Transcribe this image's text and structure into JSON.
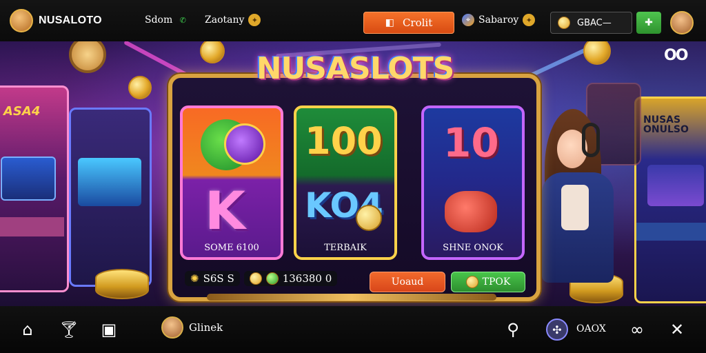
{
  "header": {
    "brand": "NUSALOTO",
    "links": [
      {
        "label": "Sdom",
        "icon": "phone-icon"
      },
      {
        "label": "Zaotany",
        "icon": "star-coin-icon"
      }
    ],
    "credit_label": "Crolit",
    "account_label": "Sabaroy",
    "balance_label": "GBAC—",
    "colors": {
      "credit": "#e5561c",
      "green": "#3cab3c",
      "gold": "#d9a340"
    }
  },
  "hero": {
    "title": "NUSASLOTS",
    "deco": "OO",
    "tiles": [
      {
        "art_text": "K",
        "label": "SOME 6100"
      },
      {
        "art_text_top": "100",
        "art_text": "KO4",
        "label": "TERBAIK"
      },
      {
        "art_text_top": "10",
        "label": "SHNE ONOK"
      }
    ],
    "stats": [
      {
        "value": "S6S S"
      },
      {
        "value": "136380 0"
      }
    ],
    "load_label": "Uoaud",
    "top_label": "TPOK",
    "left_machine_text": "ASA4",
    "right_machine_text": "NUSAS ONULSO"
  },
  "footer": {
    "user_label": "Glinek",
    "right_label": "OAOX",
    "icons": [
      "home-icon",
      "cocktail-icon",
      "screen-icon",
      "avatar",
      "chart-icon",
      "network-icon",
      "infinity-icon",
      "close-icon"
    ]
  }
}
